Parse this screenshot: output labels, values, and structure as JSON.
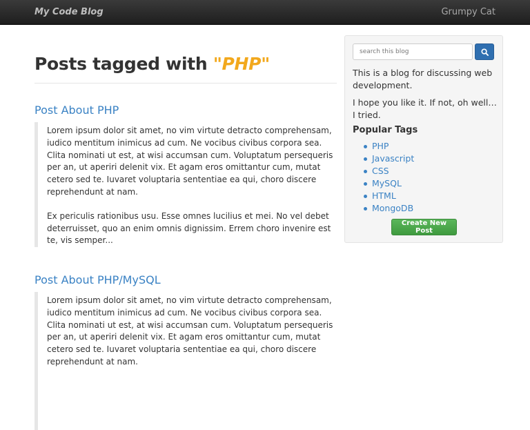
{
  "nav": {
    "brand": "My Code Blog",
    "user": "Grumpy Cat"
  },
  "main": {
    "title_prefix": "Posts tagged with ",
    "tag": "\"PHP\"",
    "posts": [
      {
        "title": "Post About PHP",
        "paragraphs": [
          " Lorem ipsum dolor sit amet, no vim virtute detracto comprehensam, iudico mentitum inimicus ad cum. Ne vocibus civibus corpora sea. Clita nominati ut est, at wisi accumsan cum. Voluptatum persequeris per an, ut aperiri delenit vix. Et agam eros omittantur cum, mutat cetero sed te. Iuvaret voluptaria sententiae ea qui, choro discere reprehendunt at nam.",
          "Ex periculis rationibus usu. Esse omnes lucilius et mei. No vel debet deterruisset, quo an enim omnis dignissim. Errem choro invenire est te, vis semper..."
        ]
      },
      {
        "title": "Post About PHP/MySQL",
        "paragraphs": [
          " Lorem ipsum dolor sit amet, no vim virtute detracto comprehensam, iudico mentitum inimicus ad cum. Ne vocibus civibus corpora sea. Clita nominati ut est, at wisi accumsan cum. Voluptatum persequeris per an, ut aperiri delenit vix. Et agam eros omittantur cum, mutat cetero sed te. Iuvaret voluptaria sententiae ea qui, choro discere reprehendunt at nam."
        ]
      }
    ]
  },
  "sidebar": {
    "search_placeholder": "search this blog",
    "search_icon": "search-icon",
    "about_1": "This is a blog for discussing web development.",
    "about_2": "I hope you like it. If not, oh well… I tried.",
    "tags_heading": "Popular Tags",
    "tags": [
      "PHP",
      "Javascript",
      "CSS",
      "MySQL",
      "HTML",
      "MongoDB"
    ],
    "create_label": "Create New Post"
  },
  "colors": {
    "link": "#3a82c4",
    "tag_highlight": "#f2a81d",
    "search_button": "#2f6fb0",
    "create_button": "#4cae4c"
  }
}
